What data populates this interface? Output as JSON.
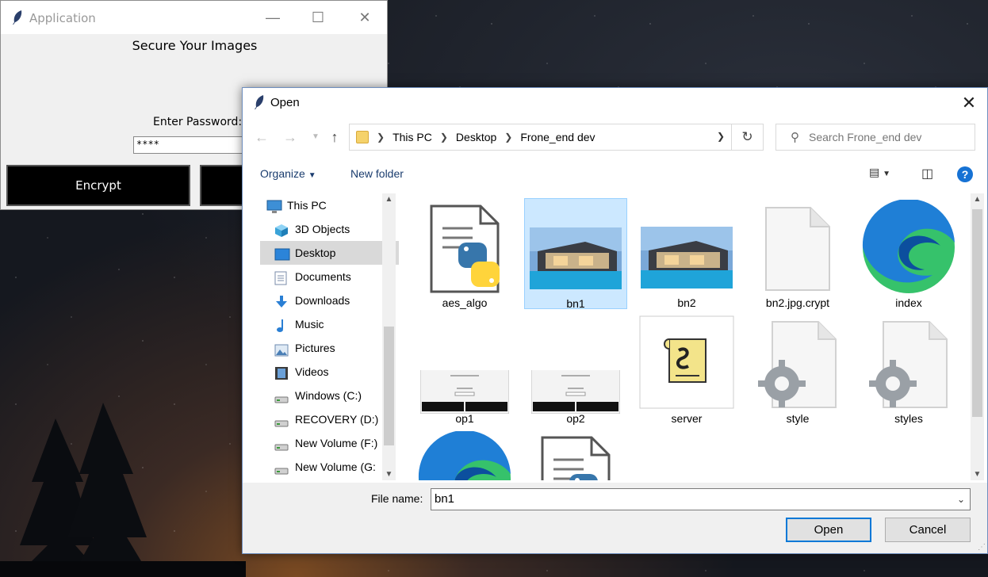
{
  "app": {
    "title": "Application",
    "heading": "Secure Your Images",
    "password_label": "Enter Password:",
    "password_value": "****",
    "encrypt_label": "Encrypt"
  },
  "dialog": {
    "title": "Open",
    "breadcrumb": [
      "This PC",
      "Desktop",
      "Frone_end dev"
    ],
    "search_placeholder": "Search Frone_end dev",
    "organize_label": "Organize",
    "new_folder_label": "New folder",
    "nav_items": [
      {
        "label": "This PC",
        "icon": "pc-icon"
      },
      {
        "label": "3D Objects",
        "icon": "cube-icon"
      },
      {
        "label": "Desktop",
        "icon": "desktop-icon",
        "selected": true
      },
      {
        "label": "Documents",
        "icon": "document-icon"
      },
      {
        "label": "Downloads",
        "icon": "download-icon"
      },
      {
        "label": "Music",
        "icon": "music-icon"
      },
      {
        "label": "Pictures",
        "icon": "pictures-icon"
      },
      {
        "label": "Videos",
        "icon": "video-icon"
      },
      {
        "label": "Windows (C:)",
        "icon": "drive-icon"
      },
      {
        "label": "RECOVERY (D:)",
        "icon": "drive-icon"
      },
      {
        "label": "New Volume (F:)",
        "icon": "drive-icon"
      },
      {
        "label": "New Volume (G:",
        "icon": "drive-icon"
      }
    ],
    "files": [
      {
        "name": "aes_algo",
        "icon": "python-file-icon"
      },
      {
        "name": "bn1",
        "icon": "image-thumbnail",
        "selected": true
      },
      {
        "name": "bn2",
        "icon": "image-thumbnail"
      },
      {
        "name": "bn2.jpg.crypt",
        "icon": "blank-file-icon"
      },
      {
        "name": "index",
        "icon": "edge-icon"
      },
      {
        "name": "op1",
        "icon": "screenshot-thumbnail"
      },
      {
        "name": "op2",
        "icon": "screenshot-thumbnail"
      },
      {
        "name": "server",
        "icon": "script-icon"
      },
      {
        "name": "style",
        "icon": "settings-file-icon"
      },
      {
        "name": "styles",
        "icon": "settings-file-icon"
      },
      {
        "name": "",
        "icon": "edge-icon"
      },
      {
        "name": "",
        "icon": "python-file-icon"
      }
    ],
    "file_name_label": "File name:",
    "file_name_value": "bn1",
    "open_label": "Open",
    "cancel_label": "Cancel"
  }
}
